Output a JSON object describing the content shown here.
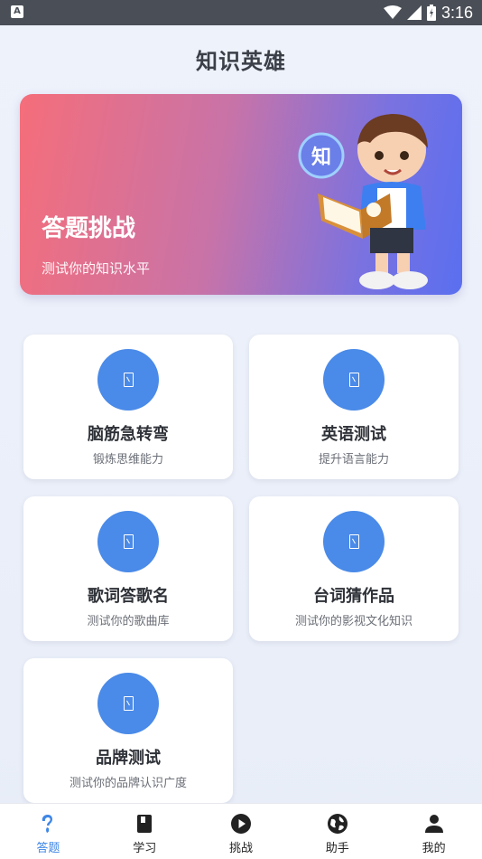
{
  "status_bar": {
    "time": "3:16",
    "app_icon_letter": "A"
  },
  "page": {
    "title": "知识英雄"
  },
  "banner": {
    "title": "答题挑战",
    "subtitle": "测试你的知识水平",
    "mascot_badge": "知"
  },
  "cards": [
    {
      "title": "脑筋急转弯",
      "subtitle": "锻炼思维能力",
      "icon": "missing-glyph-icon"
    },
    {
      "title": "英语测试",
      "subtitle": "提升语言能力",
      "icon": "missing-glyph-icon"
    },
    {
      "title": "歌词答歌名",
      "subtitle": "测试你的歌曲库",
      "icon": "missing-glyph-icon"
    },
    {
      "title": "台词猜作品",
      "subtitle": "测试你的影视文化知识",
      "icon": "missing-glyph-icon"
    },
    {
      "title": "品牌测试",
      "subtitle": "测试你的品牌认识广度",
      "icon": "missing-glyph-icon"
    }
  ],
  "bottom_nav": {
    "active_color": "#3f86e6",
    "items": [
      {
        "label": "答题",
        "icon": "quiz-icon",
        "active": true
      },
      {
        "label": "学习",
        "icon": "book-icon",
        "active": false
      },
      {
        "label": "挑战",
        "icon": "play-icon",
        "active": false
      },
      {
        "label": "助手",
        "icon": "globe-icon",
        "active": false
      },
      {
        "label": "我的",
        "icon": "person-icon",
        "active": false
      }
    ]
  }
}
